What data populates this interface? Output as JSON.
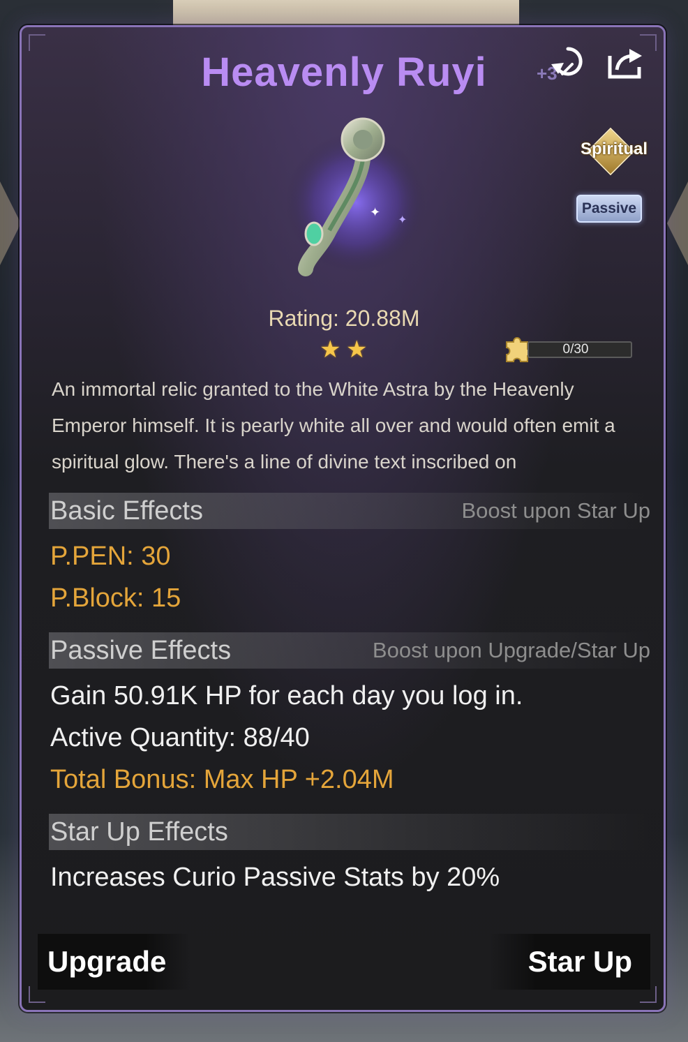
{
  "curio": {
    "name": "Heavenly Ruyi",
    "plus_level": "+3",
    "tags": {
      "spiritual": "Spiritual",
      "passive": "Passive"
    },
    "rating_text": "Rating: 20.88M",
    "stars": 2,
    "shards": "0/30",
    "description": "An immortal relic granted to the White Astra by the Heavenly Emperor himself. It is pearly white all over and would often emit a spiritual glow. There's a line of divine text inscribed on"
  },
  "basic_effects": {
    "title": "Basic Effects",
    "subtitle": "Boost upon Star Up",
    "stats": [
      "P.PEN: 30",
      "P.Block: 15"
    ]
  },
  "passive_effects": {
    "title": "Passive Effects",
    "subtitle": "Boost upon Upgrade/Star Up",
    "line1": "Gain 50.91K HP for each day you log in.",
    "line2": "Active Quantity: 88/40",
    "line3": "Total Bonus: Max HP +2.04M"
  },
  "star_up_effects": {
    "title": "Star Up Effects",
    "line1": "Increases Curio Passive Stats by 20%"
  },
  "buttons": {
    "upgrade": "Upgrade",
    "star_up": "Star Up"
  },
  "icons": [
    "refresh-icon",
    "share-icon",
    "puzzle-piece-icon",
    "star-icon"
  ],
  "colors": {
    "title": "#b98cf2",
    "gold": "#e4a53a",
    "panel_border": "#8a74b8"
  }
}
